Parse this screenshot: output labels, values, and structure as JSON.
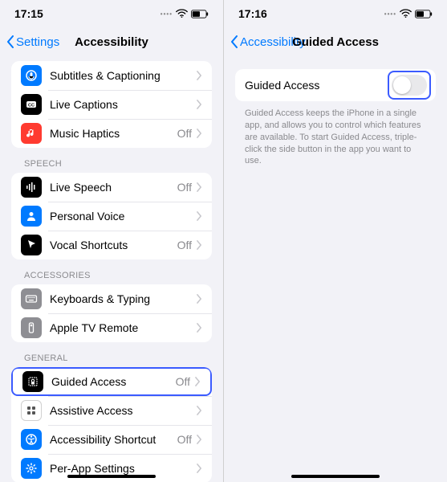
{
  "left": {
    "status": {
      "time": "17:15"
    },
    "nav": {
      "back": "Settings",
      "title": "Accessibility"
    },
    "group1": [
      {
        "icon": "mic-icon",
        "color": "ico-blue",
        "label": "Subtitles & Captioning",
        "value": ""
      },
      {
        "icon": "cc-icon",
        "color": "ico-black",
        "label": "Live Captions",
        "value": ""
      },
      {
        "icon": "music-icon",
        "color": "ico-red",
        "label": "Music Haptics",
        "value": "Off"
      }
    ],
    "speech_header": "SPEECH",
    "group2": [
      {
        "icon": "wave-icon",
        "color": "ico-black",
        "label": "Live Speech",
        "value": "Off"
      },
      {
        "icon": "person-icon",
        "color": "ico-blue",
        "label": "Personal Voice",
        "value": ""
      },
      {
        "icon": "cursor-icon",
        "color": "ico-black",
        "label": "Vocal Shortcuts",
        "value": "Off"
      }
    ],
    "acc_header": "ACCESSORIES",
    "group3": [
      {
        "icon": "keyboard-icon",
        "color": "ico-gray",
        "label": "Keyboards & Typing",
        "value": ""
      },
      {
        "icon": "remote-icon",
        "color": "ico-gray",
        "label": "Apple TV Remote",
        "value": ""
      }
    ],
    "gen_header": "GENERAL",
    "group4": [
      {
        "icon": "lock-icon",
        "color": "ico-black",
        "label": "Guided Access",
        "value": "Off",
        "highlight": true
      },
      {
        "icon": "grid-icon",
        "color": "ico-outline",
        "label": "Assistive Access",
        "value": ""
      },
      {
        "icon": "a11y-icon",
        "color": "ico-blue",
        "label": "Accessibility Shortcut",
        "value": "Off"
      },
      {
        "icon": "gear-icon",
        "color": "ico-blue",
        "label": "Per-App Settings",
        "value": ""
      }
    ]
  },
  "right": {
    "status": {
      "time": "17:16"
    },
    "nav": {
      "back": "Accessibility",
      "title": "Guided Access"
    },
    "toggle": {
      "label": "Guided Access",
      "on": false
    },
    "footer": "Guided Access keeps the iPhone in a single app, and allows you to control which features are available. To start Guided Access, triple-click the side button in the app you want to use."
  }
}
